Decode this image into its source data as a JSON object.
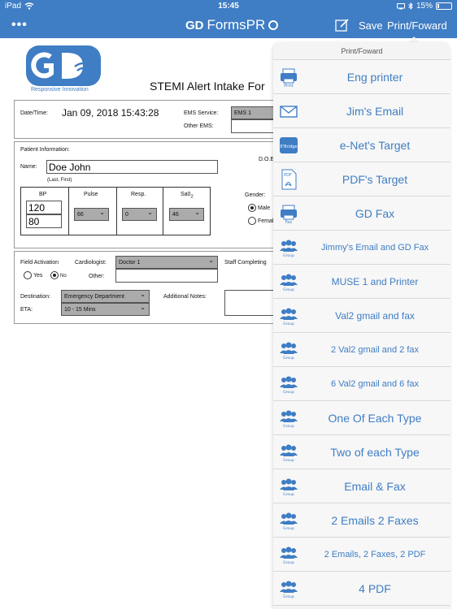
{
  "status": {
    "device": "iPad",
    "time": "15:45",
    "battery": "15%",
    "battery_level": 0.15
  },
  "nav": {
    "menu": "•••",
    "brand_gd": "GD",
    "brand_name": "FormsPR",
    "save": "Save",
    "print": "Print/Foward"
  },
  "logo": {
    "tagline": "Responsive Innovation"
  },
  "form": {
    "title": "STEMI Alert Intake For",
    "date_label": "Date/Time:",
    "date_value": "Jan 09, 2018 15:43:28",
    "ems_service_label": "EMS Service:",
    "ems_service_value": "EMS 1",
    "other_ems_label": "Other EMS:",
    "patient_info_label": "Patient Information:",
    "dob_label": "D.O.E",
    "name_label": "Name:",
    "name_value": "Doe John",
    "name_hint": "(Last, First)",
    "bp_label": "BP",
    "bp_systolic": "120",
    "bp_diastolic": "80",
    "pulse_label": "Pulse",
    "pulse_value": "66",
    "resp_label": "Resp.",
    "resp_value": "0",
    "sao2_label": "Sa0",
    "sao2_sub": "2",
    "sao2_value": "46",
    "gender_label": "Gender:",
    "gender_male": "Male",
    "gender_female": "Femal",
    "field_activation_label": "Field Activation",
    "yes_label": "Yes",
    "no_label": "No",
    "cardiologist_label": "Cardiologist:",
    "cardiologist_value": "Doctor 1",
    "other_label": "Other:",
    "staff_label": "Staff Completing",
    "destination_label": "Destination:",
    "destination_value": "Emergency Department",
    "eta_label": "ETA:",
    "eta_value": "10 - 15 Mins",
    "notes_label": "Additional Notes:"
  },
  "popover": {
    "title": "Print/Foward",
    "items": [
      {
        "label": "Eng printer",
        "icon": "printer-icon",
        "icon_text": "Print"
      },
      {
        "label": "Jim's Email",
        "icon": "email-icon",
        "icon_text": ""
      },
      {
        "label": "e-Net's Target",
        "icon": "ebridge-icon",
        "icon_text": "E'Bridge"
      },
      {
        "label": "PDF's Target",
        "icon": "pdf-icon",
        "icon_text": "PDF"
      },
      {
        "label": "GD Fax",
        "icon": "fax-icon",
        "icon_text": "Fax"
      },
      {
        "label": "Jimmy's Email and GD Fax",
        "icon": "group-icon",
        "icon_text": "Group"
      },
      {
        "label": "MUSE 1 and Printer",
        "icon": "group-icon",
        "icon_text": "Group"
      },
      {
        "label": "Val2 gmail and fax",
        "icon": "group-icon",
        "icon_text": "Group"
      },
      {
        "label": "2 Val2 gmail and 2 fax",
        "icon": "group-icon",
        "icon_text": "Group"
      },
      {
        "label": "6 Val2 gmail and 6 fax",
        "icon": "group-icon",
        "icon_text": "Group"
      },
      {
        "label": "One Of Each Type",
        "icon": "group-icon",
        "icon_text": "Group"
      },
      {
        "label": "Two of each Type",
        "icon": "group-icon",
        "icon_text": "Group"
      },
      {
        "label": "Email & Fax",
        "icon": "group-icon",
        "icon_text": "Group"
      },
      {
        "label": "2 Emails 2 Faxes",
        "icon": "group-icon",
        "icon_text": "Group"
      },
      {
        "label": "2 Emails, 2 Faxes, 2 PDF",
        "icon": "group-icon",
        "icon_text": "Group"
      },
      {
        "label": "4 PDF",
        "icon": "group-icon",
        "icon_text": "Group"
      }
    ]
  },
  "colors": {
    "accent": "#3f7dc4",
    "dropdown": "#ababab"
  }
}
